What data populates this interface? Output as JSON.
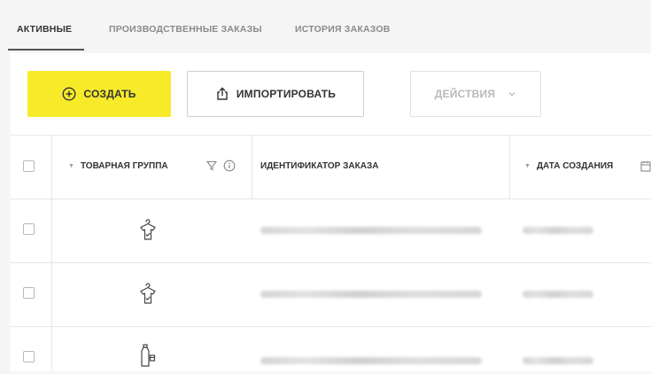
{
  "tabs": [
    {
      "label": "АКТИВНЫЕ",
      "active": true
    },
    {
      "label": "ПРОИЗВОДСТВЕННЫЕ ЗАКАЗЫ",
      "active": false
    },
    {
      "label": "ИСТОРИЯ ЗАКАЗОВ",
      "active": false
    }
  ],
  "toolbar": {
    "create_label": "СОЗДАТЬ",
    "import_label": "ИМПОРТИРОВАТЬ",
    "actions_label": "ДЕЙСТВИЯ"
  },
  "table": {
    "columns": {
      "product_group": "ТОВАРНАЯ ГРУППА",
      "order_id": "ИДЕНТИФИКАТОР ЗАКАЗА",
      "created_at": "ДАТА СОЗДАНИЯ"
    },
    "rows": [
      {
        "product_group_icon": "clothing-icon"
      },
      {
        "product_group_icon": "clothing-icon"
      },
      {
        "product_group_icon": "bottle-icon"
      }
    ]
  },
  "colors": {
    "accent_yellow": "#f7ea29",
    "border": "#e6e6e6"
  }
}
